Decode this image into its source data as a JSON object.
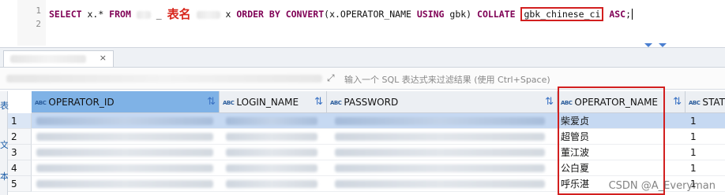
{
  "editor": {
    "line_numbers": [
      "1",
      "2"
    ],
    "sql": {
      "kw_select": "SELECT",
      "part_fields": " x.* ",
      "kw_from": "FROM",
      "table_annotation": "表名",
      "part_alias": " x ",
      "kw_order_by": "ORDER BY",
      "kw_convert": "CONVERT",
      "part_convert_open": "(x.OPERATOR_NAME ",
      "kw_using": "USING",
      "part_gbk": " gbk) ",
      "kw_collate": "COLLATE",
      "collation": "gbk_chinese_ci",
      "kw_asc": "ASC",
      "semicolon": ";"
    }
  },
  "result_tab": {
    "close_label": "×"
  },
  "filter": {
    "placeholder": "输入一个 SQL 表达式来过滤结果 (使用 Ctrl+Space)"
  },
  "grid": {
    "type_badge": "ABC",
    "sort_icon": "sort-filter-icon",
    "columns": [
      {
        "name": "OPERATOR_ID"
      },
      {
        "name": "LOGIN_NAME"
      },
      {
        "name": "PASSWORD"
      },
      {
        "name": "OPERATOR_NAME"
      },
      {
        "name": "STAT"
      }
    ],
    "rows": [
      {
        "num": "1",
        "operator_name": "柴爱贞",
        "status": "1"
      },
      {
        "num": "2",
        "operator_name": "超管员",
        "status": "1"
      },
      {
        "num": "3",
        "operator_name": "董江波",
        "status": "1"
      },
      {
        "num": "4",
        "operator_name": "公白夏",
        "status": "1"
      },
      {
        "num": "5",
        "operator_name": "呼乐湛",
        "status": "1"
      }
    ],
    "side_labels": [
      "表",
      "文",
      "本"
    ]
  },
  "watermark": "CSDN @A_Everyman",
  "colors": {
    "keyword": "#7f0055",
    "annotation_red": "#d8261c",
    "active_header": "#7fb2e6",
    "selected_row": "#c6d9f2",
    "highlight_box": "#d21f1f"
  }
}
